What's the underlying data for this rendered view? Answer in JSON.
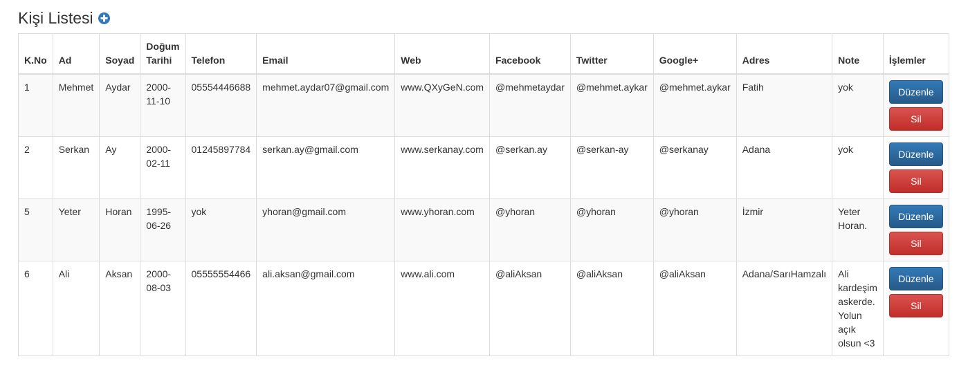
{
  "header": {
    "title": "Kişi Listesi",
    "add_icon": "plus-circle-icon"
  },
  "table": {
    "columns": [
      "K.No",
      "Ad",
      "Soyad",
      "Doğum Tarihi",
      "Telefon",
      "Email",
      "Web",
      "Facebook",
      "Twitter",
      "Google+",
      "Adres",
      "Note",
      "İşlemler"
    ],
    "rows": [
      {
        "kno": "1",
        "ad": "Mehmet",
        "soyad": "Aydar",
        "dogum": "2000-11-10",
        "telefon": "05554446688",
        "email": "mehmet.aydar07@gmail.com",
        "web": "www.QXyGeN.com",
        "facebook": "@mehmetaydar",
        "twitter": "@mehmet.aykar",
        "google": "@mehmet.aykar",
        "adres": "Fatih",
        "note": "yok"
      },
      {
        "kno": "2",
        "ad": "Serkan",
        "soyad": "Ay",
        "dogum": "2000-02-11",
        "telefon": "01245897784",
        "email": "serkan.ay@gmail.com",
        "web": "www.serkanay.com",
        "facebook": "@serkan.ay",
        "twitter": "@serkan-ay",
        "google": "@serkanay",
        "adres": "Adana",
        "note": "yok"
      },
      {
        "kno": "5",
        "ad": "Yeter",
        "soyad": "Horan",
        "dogum": "1995-06-26",
        "telefon": "yok",
        "email": "yhoran@gmail.com",
        "web": "www.yhoran.com",
        "facebook": "@yhoran",
        "twitter": "@yhoran",
        "google": "@yhoran",
        "adres": "İzmir",
        "note": "Yeter Horan."
      },
      {
        "kno": "6",
        "ad": "Ali",
        "soyad": "Aksan",
        "dogum": "2000-08-03",
        "telefon": "05555554466",
        "email": "ali.aksan@gmail.com",
        "web": "www.ali.com",
        "facebook": "@aliAksan",
        "twitter": "@aliAksan",
        "google": "@aliAksan",
        "adres": "Adana/SarıHamzalı",
        "note": "Ali kardeşim askerde. Yolun açık olsun <3"
      }
    ],
    "edit_label": "Düzenle",
    "delete_label": "Sil"
  },
  "colors": {
    "edit_button": "#337ab7",
    "delete_button": "#d9534f",
    "add_icon": "#337ab7"
  }
}
